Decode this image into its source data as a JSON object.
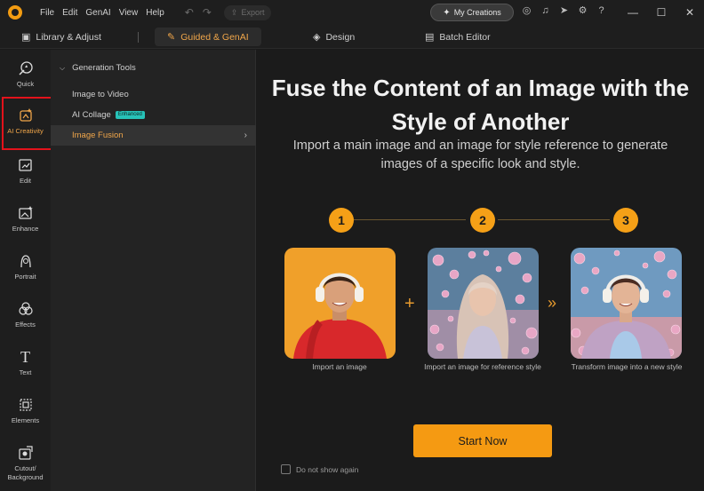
{
  "titlebar": {
    "menu": [
      "File",
      "Edit",
      "GenAI",
      "View",
      "Help"
    ],
    "export_label": "Export",
    "my_creations_label": "My Creations",
    "icons": [
      "user-icon",
      "bell-icon",
      "send-icon",
      "gear-icon",
      "help-icon"
    ]
  },
  "modes": {
    "library": "Library & Adjust",
    "guided": "Guided & GenAI",
    "design": "Design",
    "batch": "Batch Editor"
  },
  "rail": {
    "items": [
      {
        "label": "Quick"
      },
      {
        "label": "AI Creativity"
      },
      {
        "label": "Edit"
      },
      {
        "label": "Enhance"
      },
      {
        "label": "Portrait"
      },
      {
        "label": "Effects"
      },
      {
        "label": "Text"
      },
      {
        "label": "Elements"
      },
      {
        "label": "Cutout/ Background"
      }
    ]
  },
  "subpanel": {
    "heading": "Generation Tools",
    "items": [
      {
        "label": "Image to Video",
        "badge": ""
      },
      {
        "label": "AI Collage",
        "badge": "Enhanced"
      },
      {
        "label": "Image Fusion",
        "badge": ""
      }
    ]
  },
  "main": {
    "title": "Fuse the Content of an Image with the Style of Another",
    "subtitle": "Import a main image and an image for style reference to generate images of a specific look and style.",
    "steps": [
      {
        "num": "1",
        "caption": "Import an image"
      },
      {
        "num": "2",
        "caption": "Import an image for reference style"
      },
      {
        "num": "3",
        "caption": "Transform image into a new style"
      }
    ],
    "start_label": "Start Now",
    "noshow_label": "Do not show again"
  },
  "colors": {
    "accent": "#f5a017",
    "highlight_box": "#e3121b",
    "badge": "#27c2b8"
  }
}
